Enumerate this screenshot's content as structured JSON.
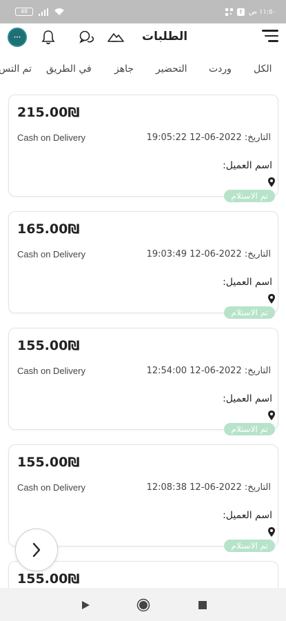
{
  "status_bar": {
    "time": "١١:٥٠ ص",
    "battery": "48"
  },
  "header": {
    "title": "الطلبات",
    "avatar_text": "•••"
  },
  "tabs": [
    {
      "label": "الكل"
    },
    {
      "label": "وردت"
    },
    {
      "label": "التحضير"
    },
    {
      "label": "جاهز"
    },
    {
      "label": "في الطريق"
    },
    {
      "label": "تم التس"
    }
  ],
  "orders": [
    {
      "amount": "215.00₪",
      "payment": "Cash on Delivery",
      "date_label": "التاريخ:",
      "date_value": "2022-06-12 19:05:22",
      "customer_label": "اسم العميل:",
      "status": "تم الاستلام"
    },
    {
      "amount": "165.00₪",
      "payment": "Cash on Delivery",
      "date_label": "التاريخ:",
      "date_value": "2022-06-12 19:03:49",
      "customer_label": "اسم العميل:",
      "status": "تم الاستلام"
    },
    {
      "amount": "155.00₪",
      "payment": "Cash on Delivery",
      "date_label": "التاريخ:",
      "date_value": "2022-06-12 12:54:00",
      "customer_label": "اسم العميل:",
      "status": "تم الاستلام"
    },
    {
      "amount": "155.00₪",
      "payment": "Cash on Delivery",
      "date_label": "التاريخ:",
      "date_value": "2022-06-12 12:08:38",
      "customer_label": "اسم العميل:",
      "status": "تم الاستلام"
    },
    {
      "amount": "155.00₪"
    }
  ],
  "colors": {
    "status_badge": "#b6e3c9",
    "avatar": "#1f6f75",
    "status_bar": "#bdbdbd"
  },
  "icons": {
    "header": [
      "avatar",
      "bell-icon",
      "chat-icon",
      "mountain-icon",
      "menu-icon"
    ],
    "nav": [
      "back-triangle-icon",
      "home-circle-icon",
      "recents-square-icon"
    ],
    "fab": "chevron-right-icon"
  }
}
